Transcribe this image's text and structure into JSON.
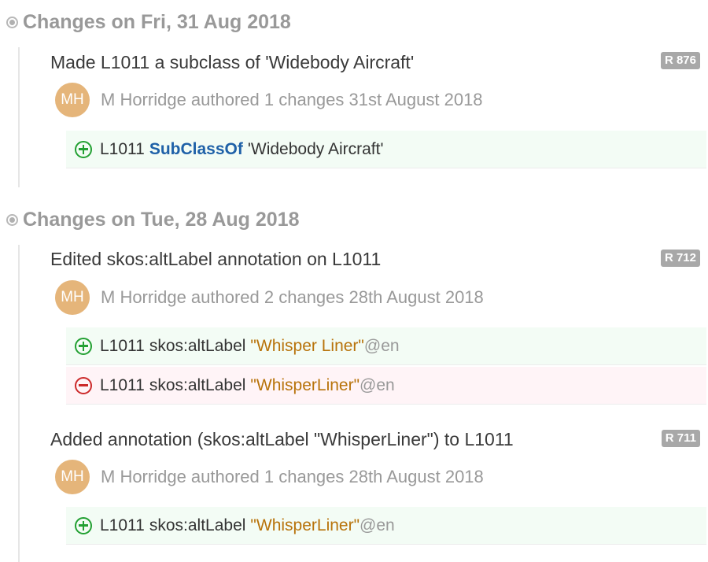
{
  "days": [
    {
      "title": "Changes on Fri, 31 Aug 2018",
      "revisions": [
        {
          "title": "Made L1011 a subclass of 'Widebody Aircraft'",
          "badge": "R 876",
          "avatar": "MH",
          "author_text": "M Horridge authored 1 changes 31st August 2018",
          "changes": [
            {
              "op": "add",
              "subject": "L1011",
              "keyword": "SubClassOf",
              "object": "'Widebody Aircraft'"
            }
          ]
        }
      ]
    },
    {
      "title": "Changes on Tue, 28 Aug 2018",
      "revisions": [
        {
          "title": "Edited skos:altLabel annotation on L1011",
          "badge": "R 712",
          "avatar": "MH",
          "author_text": "M Horridge authored 2 changes 28th August 2018",
          "changes": [
            {
              "op": "add",
              "subject": "L1011",
              "property": "skos:altLabel",
              "literal": "\"Whisper Liner\"",
              "lang": "@en"
            },
            {
              "op": "remove",
              "subject": "L1011",
              "property": "skos:altLabel",
              "literal": "\"WhisperLiner\"",
              "lang": "@en"
            }
          ]
        },
        {
          "title": "Added annotation (skos:altLabel \"WhisperLiner\") to L1011",
          "badge": "R 711",
          "avatar": "MH",
          "author_text": "M Horridge authored 1 changes 28th August 2018",
          "changes": [
            {
              "op": "add",
              "subject": "L1011",
              "property": "skos:altLabel",
              "literal": "\"WhisperLiner\"",
              "lang": "@en"
            }
          ]
        }
      ]
    }
  ]
}
